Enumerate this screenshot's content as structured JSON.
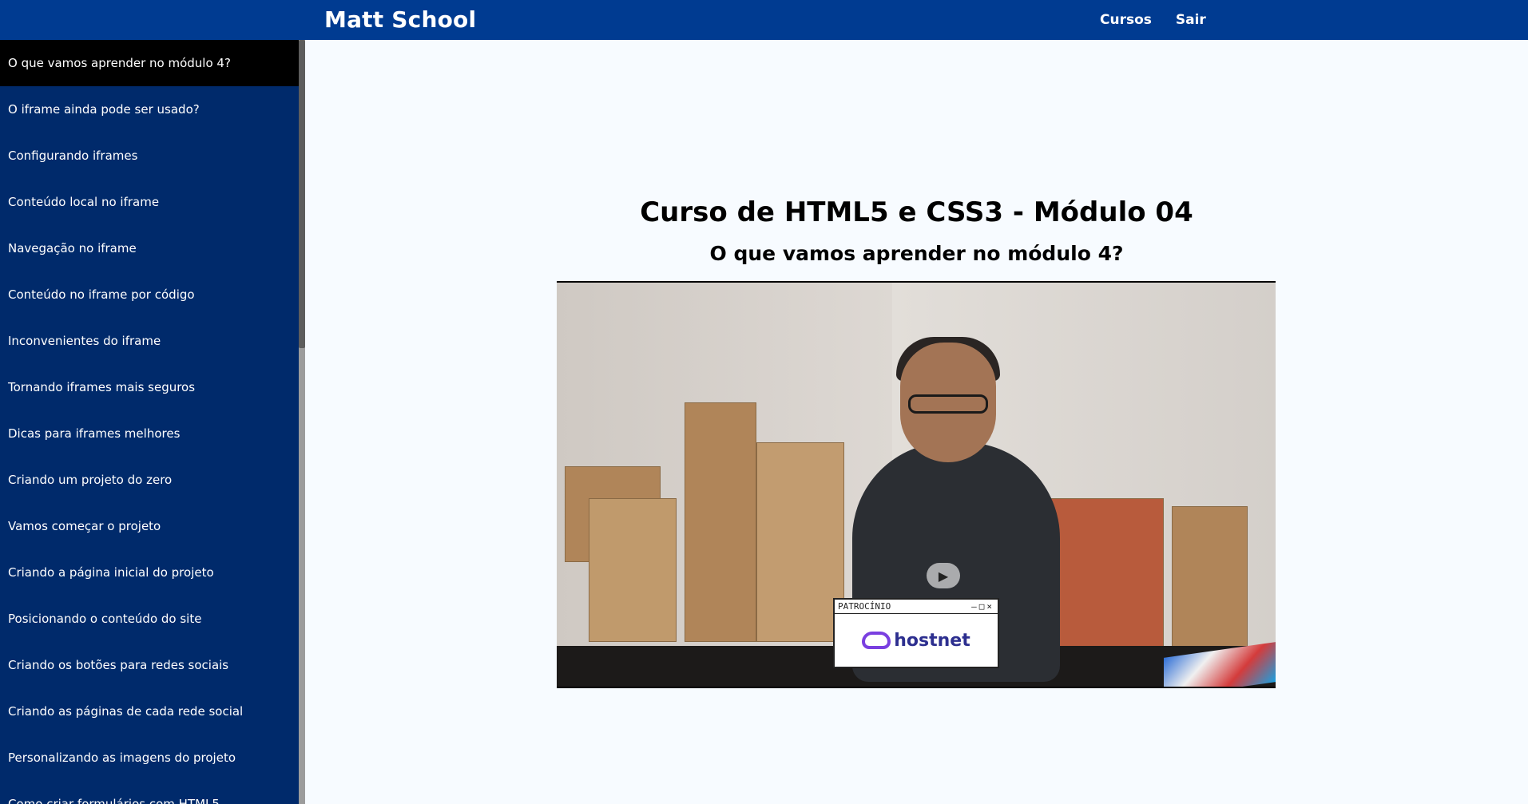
{
  "header": {
    "brand": "Matt School",
    "nav": [
      {
        "label": "Cursos"
      },
      {
        "label": "Sair"
      }
    ]
  },
  "sidebar": {
    "items": [
      {
        "label": "O que vamos aprender no módulo 4?",
        "active": true
      },
      {
        "label": "O iframe ainda pode ser usado?"
      },
      {
        "label": "Configurando iframes"
      },
      {
        "label": "Conteúdo local no iframe"
      },
      {
        "label": "Navegação no iframe"
      },
      {
        "label": "Conteúdo no iframe por código"
      },
      {
        "label": "Inconvenientes do iframe"
      },
      {
        "label": "Tornando iframes mais seguros"
      },
      {
        "label": "Dicas para iframes melhores"
      },
      {
        "label": "Criando um projeto do zero"
      },
      {
        "label": "Vamos começar o projeto"
      },
      {
        "label": "Criando a página inicial do projeto"
      },
      {
        "label": "Posicionando o conteúdo do site"
      },
      {
        "label": "Criando os botões para redes sociais"
      },
      {
        "label": "Criando as páginas de cada rede social"
      },
      {
        "label": "Personalizando as imagens do projeto"
      },
      {
        "label": "Como criar formulários com HTML5"
      }
    ]
  },
  "main": {
    "course_title": "Curso de HTML5 e CSS3 - Módulo 04",
    "lesson_title": "O que vamos aprender no módulo 4?",
    "video": {
      "sponsor_label": "PATROCÍNIO",
      "sponsor_controls": "–□×",
      "sponsor_logo_text": "hostnet",
      "play_icon": "play-icon"
    }
  },
  "colors": {
    "header_bg": "#003b91",
    "sidebar_bg": "#002a6b",
    "active_item_bg": "#000000",
    "page_bg": "#f7fbff"
  }
}
